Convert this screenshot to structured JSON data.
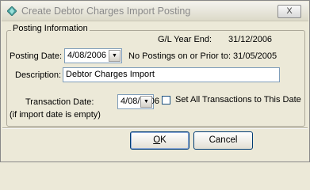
{
  "window": {
    "title": "Create Debtor Charges Import Posting",
    "close_glyph": "X"
  },
  "posting_info": {
    "legend": "Posting Information",
    "gl_year_end_label": "G/L Year End:",
    "gl_year_end_value": "31/12/2006",
    "posting_date_label": "Posting Date:",
    "posting_date_value": "4/08/2006",
    "no_postings_note": "No Postings on or Prior to: 31/05/2005",
    "description_label": "Description:",
    "description_value": "Debtor Charges Import",
    "transaction_date_label": "Transaction Date:",
    "transaction_date_value": "4/08/2006",
    "set_all_label": "Set All Transactions to This Date",
    "set_all_checked": false,
    "empty_note": "(if import date is empty)"
  },
  "buttons": {
    "ok_mnemonic": "O",
    "ok_rest": "K",
    "cancel_label": "Cancel"
  },
  "icons": {
    "app": "diamond-app-icon",
    "dropdown": "chevron-down-icon",
    "close": "close-icon"
  },
  "colors": {
    "title_text": "#8a8a8a",
    "window_bg": "#ece9d8",
    "input_border": "#7f9db9"
  }
}
